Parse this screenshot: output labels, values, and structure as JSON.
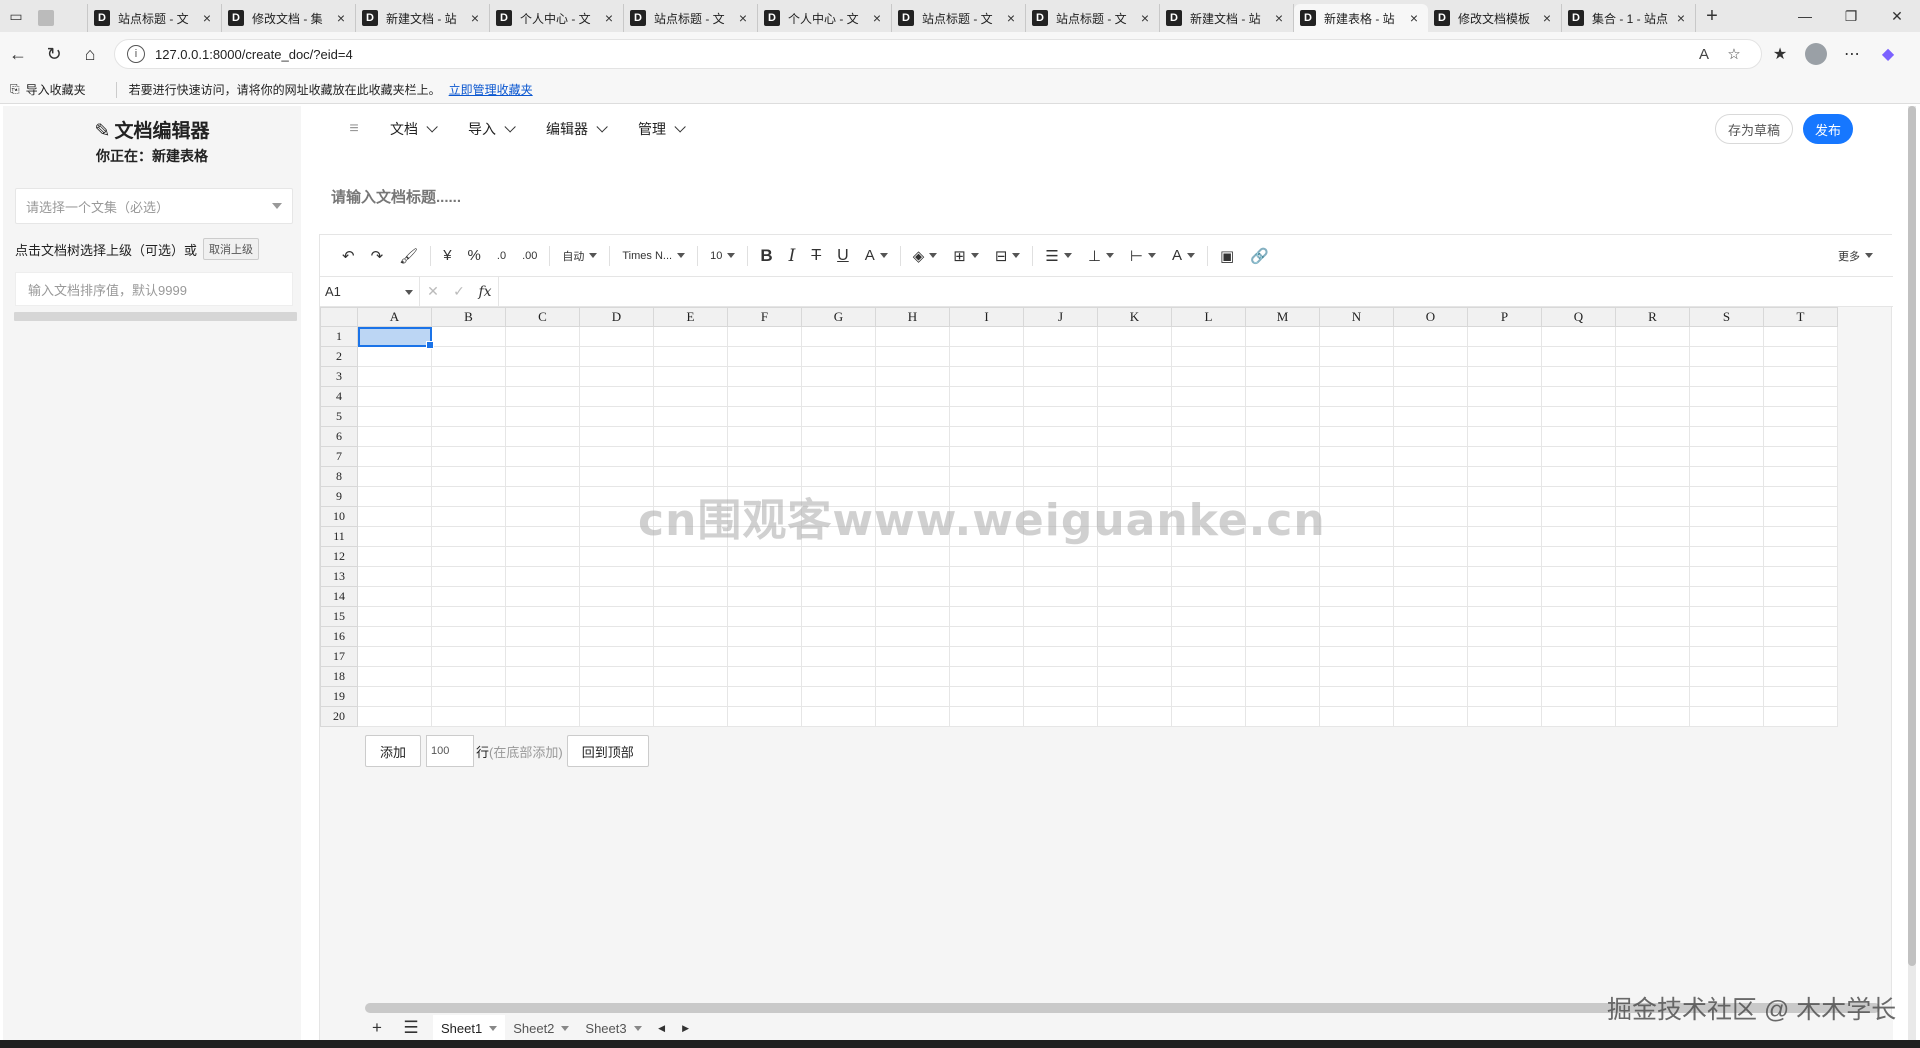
{
  "browser": {
    "tabs": [
      {
        "title": ""
      },
      {
        "title": "站点标题 - 文"
      },
      {
        "title": "修改文档 - 集"
      },
      {
        "title": "新建文档 - 站"
      },
      {
        "title": "个人中心 - 文"
      },
      {
        "title": "站点标题 - 文"
      },
      {
        "title": "个人中心 - 文"
      },
      {
        "title": "站点标题 - 文"
      },
      {
        "title": "站点标题 - 文"
      },
      {
        "title": "新建文档 - 站"
      },
      {
        "title": "新建表格 - 站"
      },
      {
        "title": "修改文档模板"
      },
      {
        "title": "集合 - 1 - 站点"
      }
    ],
    "url": "127.0.0.1:8000/create_doc/?eid=4",
    "favorites": {
      "import_label": "导入收藏夹",
      "tip": "若要进行快速访问，请将你的网址收藏放在此收藏夹栏上。",
      "manage_link": "立即管理收藏夹"
    }
  },
  "sidebar": {
    "title": "文档编辑器",
    "subtitle": "你正在：新建表格",
    "collection_placeholder": "请选择一个文集（必选）",
    "parent_hint": "点击文档树选择上级（可选）或",
    "cancel_parent": "取消上级",
    "sort_placeholder": "输入文档排序值，默认9999"
  },
  "topnav": {
    "menus": [
      "文档",
      "导入",
      "编辑器",
      "管理"
    ],
    "save_draft": "存为草稿",
    "publish": "发布"
  },
  "doc_title_placeholder": "请输入文档标题......",
  "spreadsheet": {
    "toolbar": {
      "format_auto": "自动",
      "font_name": "Times N...",
      "font_size": "10",
      "more": "更多"
    },
    "cell_ref": "A1",
    "columns": [
      "A",
      "B",
      "C",
      "D",
      "E",
      "F",
      "G",
      "H",
      "I",
      "J",
      "K",
      "L",
      "M",
      "N",
      "O",
      "P",
      "Q",
      "R",
      "S",
      "T"
    ],
    "rows": [
      "1",
      "2",
      "3",
      "4",
      "5",
      "6",
      "7",
      "8",
      "9",
      "10",
      "11",
      "12",
      "13",
      "14",
      "15",
      "16",
      "17",
      "18",
      "19",
      "20"
    ],
    "add_rows": {
      "add_button": "添加",
      "count": "100",
      "unit": "行",
      "unit_hint": "(在底部添加)",
      "back_to_top": "回到顶部"
    },
    "sheets": [
      "Sheet1",
      "Sheet2",
      "Sheet3"
    ],
    "active_sheet": "Sheet1"
  },
  "overlays": {
    "watermark": "cn围观客www.weiguanke.cn",
    "credit": "掘金技术社区 @ 木木学长"
  },
  "colors": {
    "accent": "#1677ff",
    "selection": "#bcd6f4"
  }
}
